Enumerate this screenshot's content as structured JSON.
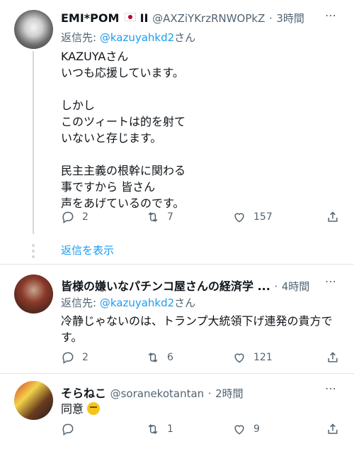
{
  "tweets": [
    {
      "name": "EMI*POM",
      "name_suffix": "II",
      "handle": "@AXZiYKrzRNWOPkZ",
      "time": "3時間",
      "reply_to_prefix": "返信先: ",
      "reply_to_handle": "@kazuyahkd2",
      "reply_to_suffix": "さん",
      "text_lines": [
        "KAZUYAさん",
        "いつも応援しています。",
        "",
        "しかし",
        "このツィートは的を射て",
        "いないと存じます。",
        "",
        "民主主義の根幹に関わる",
        "事ですから 皆さん",
        "声をあげているのです。"
      ],
      "replies": "2",
      "retweets": "7",
      "likes": "157"
    },
    {
      "name": "皆様の嫌いなパチンコ屋さんの経済学 ...",
      "time": "4時間",
      "reply_to_prefix": "返信先: ",
      "reply_to_handle": "@kazuyahkd2",
      "reply_to_suffix": "さん",
      "text_lines": [
        "冷静じゃないのは、トランプ大統領下げ連発の貴方で",
        "す。"
      ],
      "replies": "2",
      "retweets": "6",
      "likes": "121"
    },
    {
      "name": "そらねこ",
      "handle": "@soranekotantan",
      "time": "2時間",
      "text": "同意",
      "replies": "",
      "retweets": "1",
      "likes": "9"
    }
  ],
  "show_replies": "返信を表示",
  "separator_dot": "·",
  "more_icon": "⋯",
  "colors": {
    "link": "#1d9bf0",
    "muted": "#536471",
    "divider": "#e1e6e9"
  },
  "icons": [
    "reply-icon",
    "retweet-icon",
    "like-icon",
    "share-icon",
    "more-icon"
  ]
}
